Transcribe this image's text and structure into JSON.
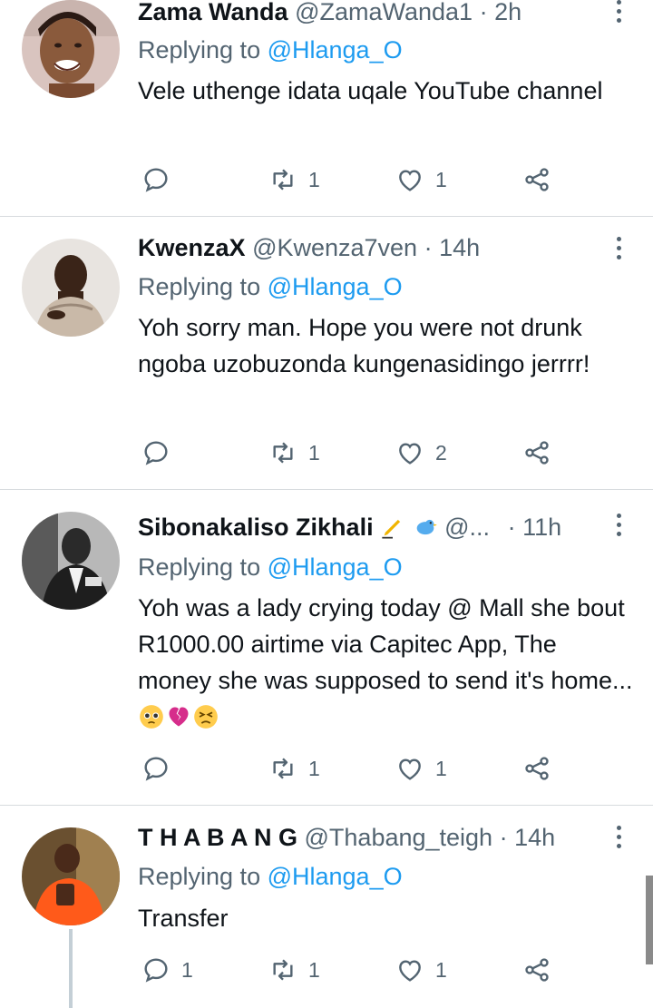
{
  "tweets": [
    {
      "name": "Zama Wanda",
      "handle": "@ZamaWanda1",
      "dot": "·",
      "time": "2h",
      "replying_prefix": "Replying to ",
      "replying_to": "@Hlanga_O",
      "text": "Vele uthenge idata uqale YouTube channel",
      "reply_count": "",
      "retweet_count": "1",
      "like_count": "1"
    },
    {
      "name": "KwenzaX",
      "handle": "@Kwenza7ven",
      "dot": "·",
      "time": "14h",
      "replying_prefix": "Replying to ",
      "replying_to": "@Hlanga_O",
      "text": "Yoh sorry man. Hope you were not drunk ngoba uzobuzonda kungenasidingo jerrrr!",
      "reply_count": "",
      "retweet_count": "1",
      "like_count": "2"
    },
    {
      "name": "Sibonakaliso Zikhali",
      "handle": "@...",
      "dot": "·",
      "time": "11h",
      "replying_prefix": "Replying to ",
      "replying_to": "@Hlanga_O",
      "text": "Yoh was a lady crying today @ Mall she bout R1000.00 airtime via Capitec App, The money she was supposed to send it's home...",
      "reply_count": "",
      "retweet_count": "1",
      "like_count": "1"
    },
    {
      "name": "T H A B A N G",
      "handle": "@Thabang_teigh",
      "dot": "·",
      "time": "14h",
      "replying_prefix": "Replying to ",
      "replying_to": "@Hlanga_O",
      "text": "Transfer",
      "reply_count": "1",
      "retweet_count": "1",
      "like_count": "1"
    }
  ],
  "icons": {
    "reply": "reply-icon",
    "retweet": "retweet-icon",
    "like": "heart-icon",
    "share": "share-icon",
    "more": "more-vertical-icon"
  },
  "colors": {
    "text": "#0f1419",
    "secondary": "#536471",
    "link": "#1d9bf0",
    "divider": "#d7dbde"
  }
}
